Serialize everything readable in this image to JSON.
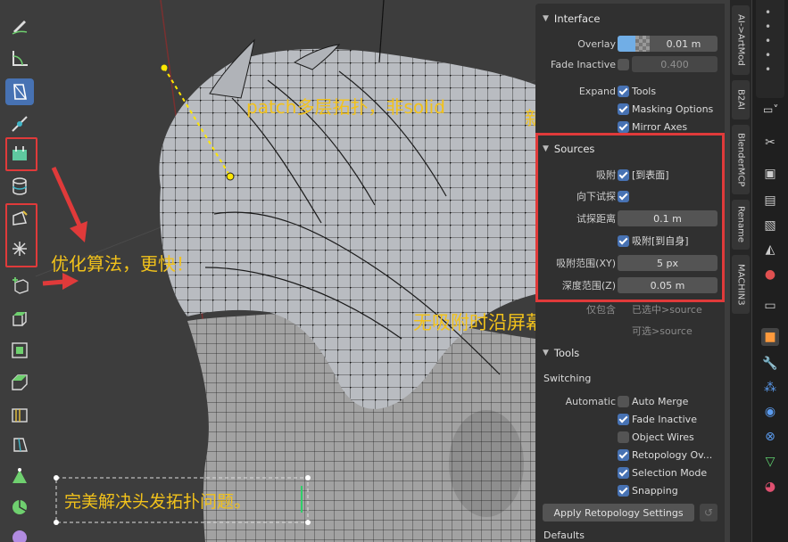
{
  "annotations": {
    "patch": "patch多层拓扑，非solid",
    "new_content": "新增内容",
    "optimize": "优化算法，更快！",
    "no_snap": "无吸附时沿屏幕坐标创建",
    "perfect": "完美解决头发拓扑问题。"
  },
  "toolbar": {
    "icons": [
      "annotate-icon",
      "measure-icon",
      "poly-build-icon",
      "edge-slide-icon",
      "retopo-patch-icon",
      "cylinder-icon",
      "quad-draw-icon",
      "relax-icon",
      "add-cube-icon",
      "extrude-icon",
      "inset-icon",
      "bevel-icon",
      "loop-cut-icon",
      "knife-icon",
      "poly-build-2-icon",
      "spin-icon",
      "sphere-icon"
    ]
  },
  "panel": {
    "interface": {
      "title": "Interface",
      "overlay_label": "Overlay",
      "overlay_value": "0.01 m",
      "overlay_fill": 0.1,
      "fade_label": "Fade Inactive",
      "fade_value": "0.400",
      "fade_checked": false,
      "expand_label": "Expand",
      "expand_items": [
        {
          "label": "Tools",
          "checked": true
        },
        {
          "label": "Masking Options",
          "checked": true
        },
        {
          "label": "Mirror Axes",
          "checked": true
        }
      ]
    },
    "sources": {
      "title": "Sources",
      "snap_label": "吸附",
      "snap_value": "[到表面]",
      "snap_checked": true,
      "probe_label": "向下试探",
      "probe_checked": true,
      "probe_dist_label": "试探距离",
      "probe_dist_value": "0.1 m",
      "self_snap_value": "吸附[到自身]",
      "self_snap_checked": true,
      "snap_range_label": "吸附范围(XY)",
      "snap_range_value": "5 px",
      "depth_range_label": "深度范围(Z)",
      "depth_range_value": "0.05 m"
    },
    "hidden": {
      "only_label": "仅包含",
      "selected_source": "已选中>source",
      "selected_source2": "可选>source"
    },
    "tools": {
      "title": "Tools",
      "switching": "Switching",
      "automatic_label": "Automatic",
      "items": [
        {
          "label": "Auto Merge",
          "checked": false
        },
        {
          "label": "Fade Inactive",
          "checked": true
        },
        {
          "label": "Object Wires",
          "checked": false
        },
        {
          "label": "Retopology Ov...",
          "checked": true
        },
        {
          "label": "Selection Mode",
          "checked": true
        },
        {
          "label": "Snapping",
          "checked": true
        }
      ],
      "apply_button": "Apply Retopology Settings",
      "defaults": "Defaults"
    }
  },
  "vtabs": [
    "AI->ArtMod",
    "B2AI",
    "BlenderMCP",
    "Rename",
    "MACHIN3"
  ],
  "props_icons": [
    "tool-icon",
    "render-icon",
    "output-icon",
    "view-layer-icon",
    "scene-icon",
    "world-icon",
    "collection-icon",
    "object-icon",
    "modifier-icon",
    "particles-icon",
    "physics-icon",
    "constraints-icon",
    "data-icon",
    "material-icon"
  ],
  "colors": {
    "accent": "#4772b3",
    "annotation": "#f2c21b",
    "highlight": "#e03a3a"
  }
}
